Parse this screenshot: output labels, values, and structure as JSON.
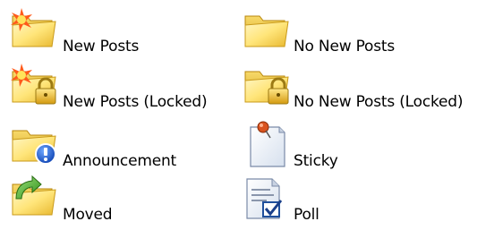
{
  "legend": {
    "items": [
      {
        "label": "New Posts",
        "icon": "new-posts-folder-icon"
      },
      {
        "label": "No New Posts",
        "icon": "no-new-posts-folder-icon"
      },
      {
        "label": "New Posts (Locked)",
        "icon": "new-posts-locked-folder-icon"
      },
      {
        "label": "No New Posts (Locked)",
        "icon": "no-new-posts-locked-folder-icon"
      },
      {
        "label": "Announcement",
        "icon": "announcement-folder-icon"
      },
      {
        "label": "Sticky",
        "icon": "sticky-note-icon"
      },
      {
        "label": "Moved",
        "icon": "moved-folder-icon"
      },
      {
        "label": "Poll",
        "icon": "poll-document-icon"
      }
    ]
  }
}
